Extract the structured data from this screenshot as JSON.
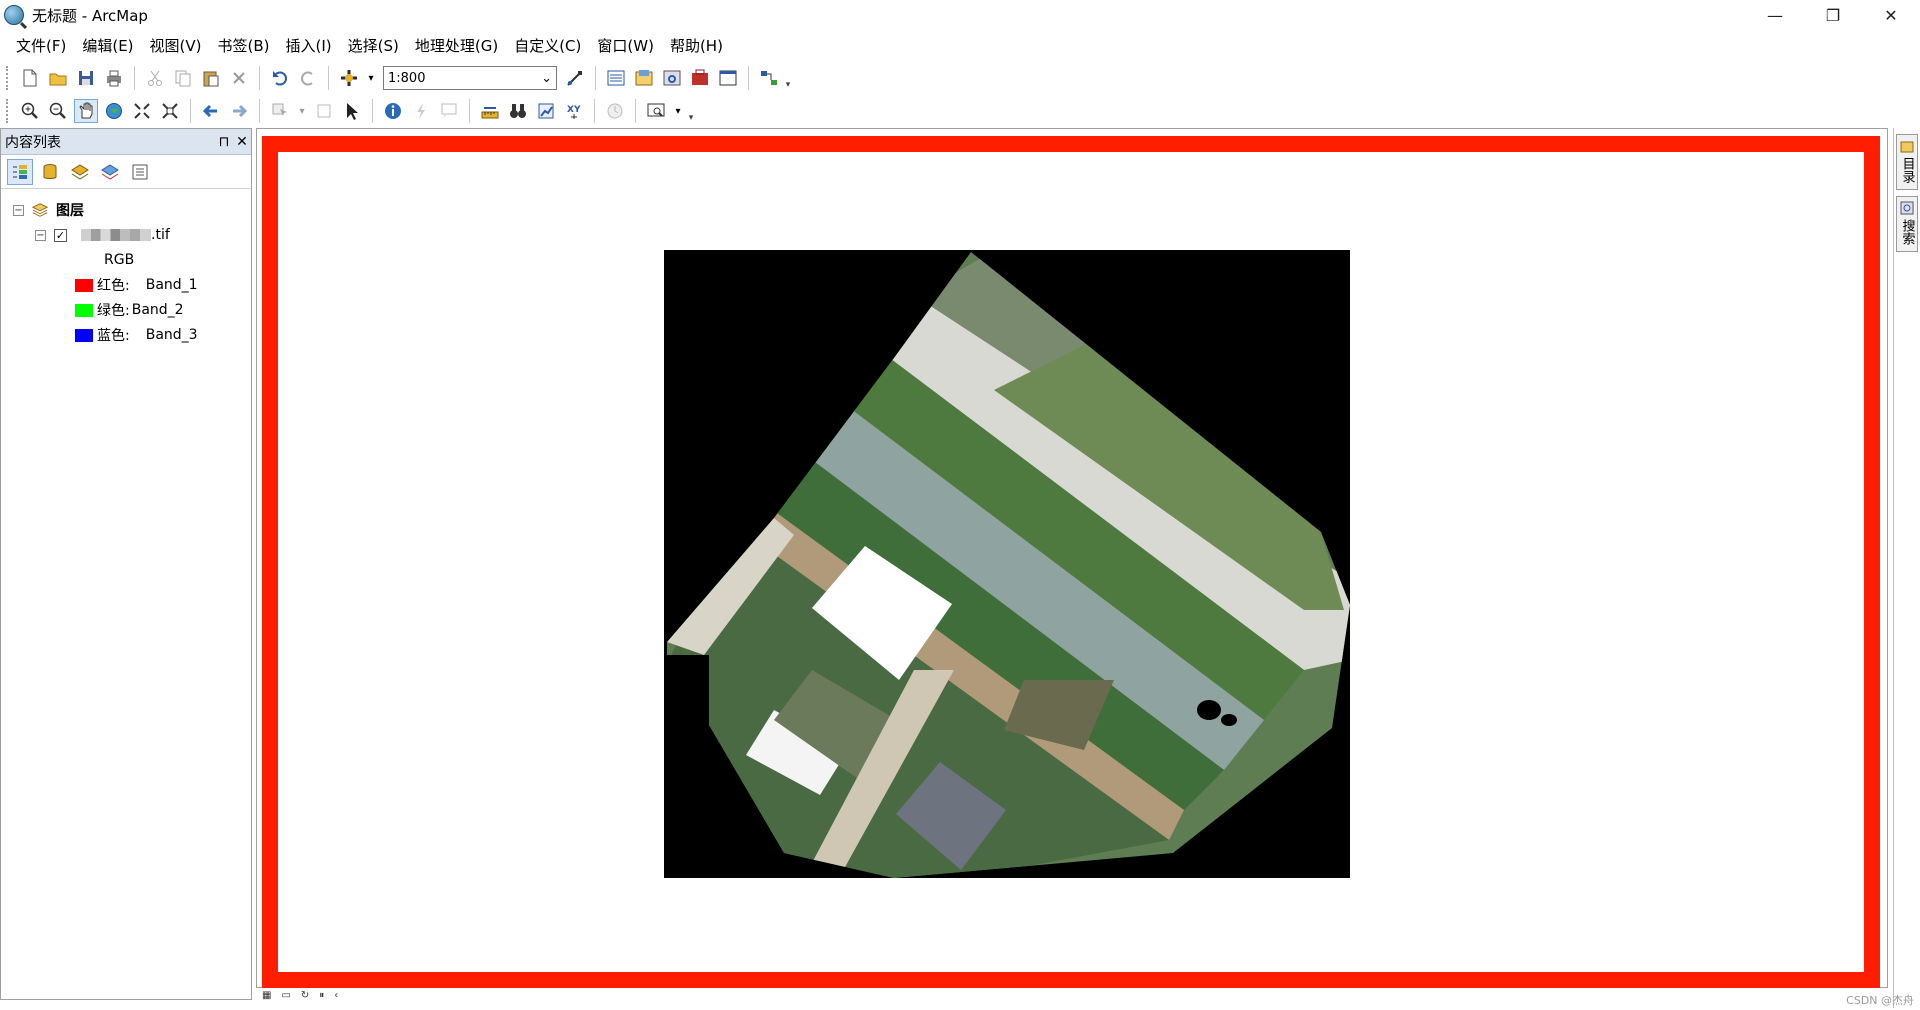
{
  "window": {
    "title": "无标题 - ArcMap",
    "controls": {
      "minimize": "—",
      "restore": "❐",
      "close": "✕"
    }
  },
  "menu": [
    "文件(F)",
    "编辑(E)",
    "视图(V)",
    "书签(B)",
    "插入(I)",
    "选择(S)",
    "地理处理(G)",
    "自定义(C)",
    "窗口(W)",
    "帮助(H)"
  ],
  "toolbar": {
    "scale_value": "1:800"
  },
  "toc": {
    "title": "内容列表",
    "pin": "⊓",
    "close": "✕",
    "layers_group": "图层",
    "layer_name_suffix": ".tif",
    "renderer": "RGB",
    "bands": [
      {
        "label": "红色:",
        "band": "Band_1",
        "color": "#ff0000"
      },
      {
        "label": "绿色:",
        "band": "Band_2",
        "color": "#00ff00"
      },
      {
        "label": "蓝色:",
        "band": "Band_3",
        "color": "#0000ff"
      }
    ],
    "checked": "✓",
    "collapse": "−"
  },
  "dock_tabs": [
    "目录",
    "搜索"
  ],
  "watermark": "CSDN @杰舟",
  "colors": {
    "frame_red": "#ff1e00",
    "toc_header": "#dbe4ef"
  }
}
